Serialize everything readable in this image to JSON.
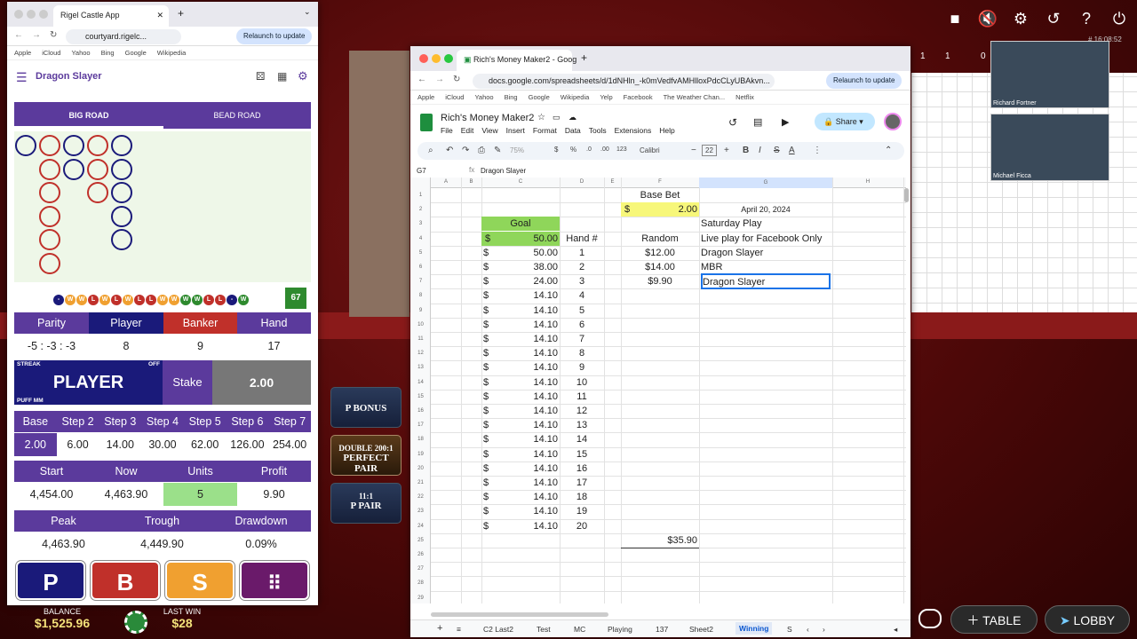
{
  "casino": {
    "clock": "# 16:08:52",
    "counts": [
      "1",
      "1",
      "0"
    ],
    "balance_label": "BALANCE",
    "balance": "$1,525.96",
    "lastwin_label": "LAST WIN",
    "lastwin": "$28",
    "table_label": "TABLE",
    "lobby_label": "LOBBY",
    "bets": [
      {
        "line1": "P BONUS",
        "line2": ""
      },
      {
        "line1": "DOUBLE 200:1",
        "line2": "PERFECT PAIR"
      },
      {
        "line1": "11:1",
        "line2": "P PAIR"
      }
    ],
    "video_names": [
      "Richard Fortner",
      "Michael Ficca"
    ],
    "icons": [
      "video-icon",
      "mute-icon",
      "gear-icon",
      "history-icon",
      "help-icon",
      "power-icon"
    ]
  },
  "rigel": {
    "tab_title": "Rigel Castle App",
    "url": "courtyard.rigelc...",
    "relaunch": "Relaunch to update",
    "bookmarks": [
      "Apple",
      "iCloud",
      "Yahoo",
      "Bing",
      "Google",
      "",
      "Wikipedia"
    ],
    "app_title": "Dragon Slayer",
    "road_tabs": [
      "BIG ROAD",
      "BEAD ROAD"
    ],
    "beads": [
      {
        "c": 0,
        "r": 0,
        "k": "P"
      },
      {
        "c": 1,
        "r": 0,
        "k": "B"
      },
      {
        "c": 2,
        "r": 0,
        "k": "P"
      },
      {
        "c": 3,
        "r": 0,
        "k": "B"
      },
      {
        "c": 4,
        "r": 0,
        "k": "P"
      },
      {
        "c": 1,
        "r": 1,
        "k": "B"
      },
      {
        "c": 2,
        "r": 1,
        "k": "P"
      },
      {
        "c": 3,
        "r": 1,
        "k": "B"
      },
      {
        "c": 4,
        "r": 1,
        "k": "P"
      },
      {
        "c": 1,
        "r": 2,
        "k": "B"
      },
      {
        "c": 3,
        "r": 2,
        "k": "B"
      },
      {
        "c": 4,
        "r": 2,
        "k": "P"
      },
      {
        "c": 1,
        "r": 3,
        "k": "B"
      },
      {
        "c": 4,
        "r": 3,
        "k": "P"
      },
      {
        "c": 1,
        "r": 4,
        "k": "B"
      },
      {
        "c": 4,
        "r": 4,
        "k": "P"
      },
      {
        "c": 1,
        "r": 5,
        "k": "B"
      }
    ],
    "results": [
      {
        "t": "-",
        "k": "P"
      },
      {
        "t": "W",
        "k": "W"
      },
      {
        "t": "W",
        "k": "W"
      },
      {
        "t": "L",
        "k": "L"
      },
      {
        "t": "W",
        "k": "W"
      },
      {
        "t": "L",
        "k": "L"
      },
      {
        "t": "W",
        "k": "W"
      },
      {
        "t": "L",
        "k": "L"
      },
      {
        "t": "L",
        "k": "L"
      },
      {
        "t": "W",
        "k": "W"
      },
      {
        "t": "W",
        "k": "W"
      },
      {
        "t": "W",
        "k": "G"
      },
      {
        "t": "W",
        "k": "G"
      },
      {
        "t": "L",
        "k": "L"
      },
      {
        "t": "L",
        "k": "L"
      },
      {
        "t": "-",
        "k": "P"
      },
      {
        "t": "W",
        "k": "G"
      }
    ],
    "result_count": "67",
    "stat_headers": [
      "Parity",
      "Player",
      "Banker",
      "Hand"
    ],
    "stat_values": [
      "-5 : -3 : -3",
      "8",
      "9",
      "17"
    ],
    "streak_label": "STREAK",
    "off_label": "OFF",
    "streak_value": "PLAYER",
    "puff_label": "PUFF MM",
    "stake_label": "Stake",
    "stake_value": "2.00",
    "step_headers": [
      "Base",
      "Step 2",
      "Step 3",
      "Step 4",
      "Step 5",
      "Step 6",
      "Step 7"
    ],
    "step_values": [
      "2.00",
      "6.00",
      "14.00",
      "30.00",
      "62.00",
      "126.00",
      "254.00"
    ],
    "acct_headers": [
      "Start",
      "Now",
      "Units",
      "Profit"
    ],
    "acct_values": [
      "4,454.00",
      "4,463.90",
      "5",
      "9.90"
    ],
    "peak_headers": [
      "Peak",
      "Trough",
      "Drawdown"
    ],
    "peak_values": [
      "4,463.90",
      "4,449.90",
      "0.09%"
    ],
    "big_buttons": [
      "P",
      "B",
      "S",
      ""
    ]
  },
  "sheets": {
    "tab_title": "Rich's Money Maker2 - Goog",
    "url": "docs.google.com/spreadsheets/d/1dNHln_-k0mVedfvAMHlloxPdcCLyUBAkvn...",
    "relaunch": "Relaunch to update",
    "bookmarks": [
      "Apple",
      "iCloud",
      "Yahoo",
      "Bing",
      "Google",
      "",
      "Wikipedia",
      "Yelp",
      "Facebook",
      "The Weather Chan...",
      "Netflix"
    ],
    "doc_title": "Rich's Money Maker2",
    "menu": [
      "File",
      "Edit",
      "View",
      "Insert",
      "Format",
      "Data",
      "Tools",
      "Extensions",
      "Help"
    ],
    "share": "Share",
    "zoom": "75%",
    "font": "Calibri",
    "font_size": "22",
    "name_box": "G7",
    "formula": "Dragon Slayer",
    "col_headers": [
      "A",
      "B",
      "C",
      "D",
      "E",
      "F",
      "G",
      "H"
    ],
    "row_count": 30,
    "cells": {
      "base_bet": "Base Bet",
      "bb_dollar": "$",
      "bb_val": "2.00",
      "date": "April 20, 2024",
      "goal": "Goal",
      "goal_dollar": "$",
      "goal_val": "50.00",
      "hand_hdr": "Hand #",
      "random": "Random",
      "saturday": "Saturday Play",
      "live": "Live play for Facebook Only",
      "randoms": [
        "$12.00",
        "$14.00",
        "$9.90"
      ],
      "notes": [
        "Dragon Slayer",
        "MBR",
        "Dragon Slayer"
      ],
      "total": "$35.90"
    },
    "col_c": [
      "50.00",
      "38.00",
      "24.00",
      "14.10",
      "14.10",
      "14.10",
      "14.10",
      "14.10",
      "14.10",
      "14.10",
      "14.10",
      "14.10",
      "14.10",
      "14.10",
      "14.10",
      "14.10",
      "14.10",
      "14.10",
      "14.10",
      "14.10"
    ],
    "hands": [
      "1",
      "2",
      "3",
      "4",
      "5",
      "6",
      "7",
      "8",
      "9",
      "10",
      "11",
      "12",
      "13",
      "14",
      "15",
      "16",
      "17",
      "18",
      "19",
      "20"
    ],
    "sheet_tabs": [
      "C2 Last2",
      "Test",
      "MC",
      "Playing",
      "137",
      "Sheet2",
      "Winning",
      "S"
    ]
  }
}
